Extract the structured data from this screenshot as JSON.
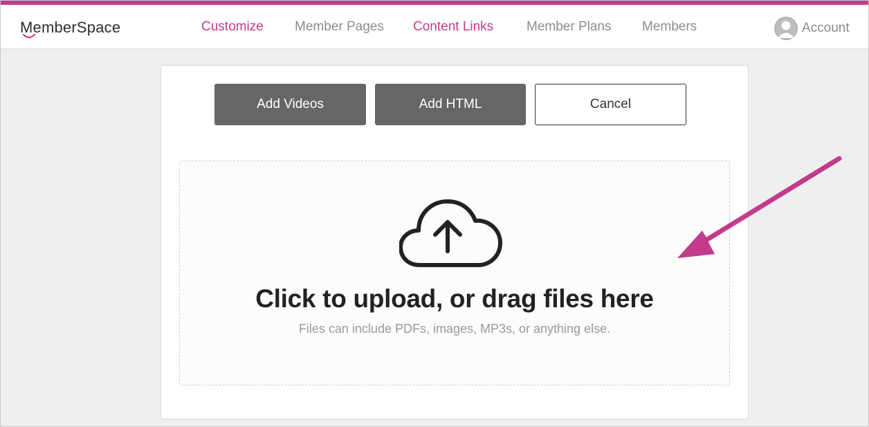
{
  "brand": {
    "logo_text": "emberSpace",
    "logo_initial": "M",
    "accent_color": "#c23b8c"
  },
  "nav": {
    "items": [
      {
        "label": "Customize",
        "active": true
      },
      {
        "label": "Member Pages",
        "active": false
      },
      {
        "label": "Content Links",
        "active": true
      },
      {
        "label": "Member Plans",
        "active": false
      },
      {
        "label": "Members",
        "active": false
      }
    ],
    "account_label": "Account",
    "account_icon": "user-avatar-icon"
  },
  "actions": {
    "add_videos": "Add Videos",
    "add_html": "Add HTML",
    "cancel": "Cancel"
  },
  "upload": {
    "icon": "cloud-upload-icon",
    "headline": "Click to upload, or drag files here",
    "subtext": "Files can include PDFs, images, MP3s, or anything else."
  },
  "annotation": {
    "arrow_color": "#c23b8c"
  }
}
